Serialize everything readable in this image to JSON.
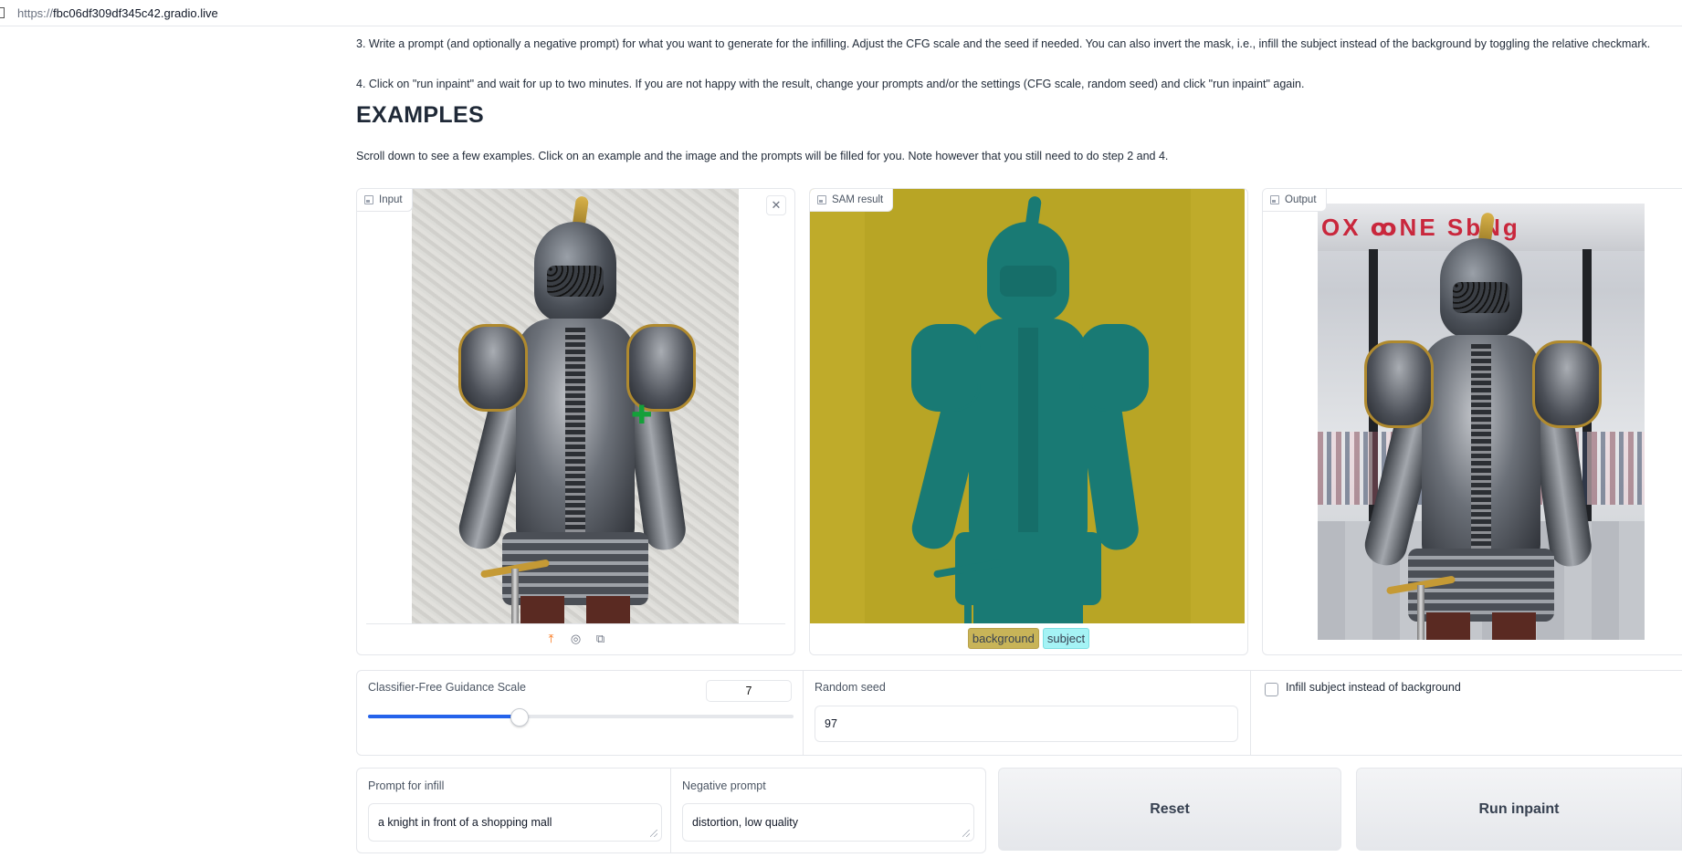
{
  "browser": {
    "url_proto": "https://",
    "url_host": "fbc06df309df345c42.gradio.live"
  },
  "instructions": {
    "step3": "3. Write a prompt (and optionally a negative prompt) for what you want to generate for the infilling. Adjust the CFG scale and the seed if needed. You can also invert the mask, i.e., infill the subject instead of the background by toggling the relative checkmark.",
    "step4": "4. Click on \"run inpaint\" and wait for up to two minutes. If you are not happy with the result, change your prompts and/or the settings (CFG scale, random seed) and click \"run inpaint\" again."
  },
  "examples": {
    "title": "EXAMPLES",
    "note": "Scroll down to see a few examples. Click on an example and the image and the prompts will be filled for you. Note however that you still need to do step 2 and 4."
  },
  "panels": {
    "input_label": "Input",
    "sam_label": "SAM result",
    "output_label": "Output",
    "close_symbol": "✕",
    "legend": {
      "background": "background",
      "subject": "subject"
    },
    "output_sign": "OX ꝏNE SbNg"
  },
  "controls": {
    "cfg_label": "Classifier-Free Guidance Scale",
    "cfg_value": "7",
    "cfg_fraction": 0.355,
    "seed_label": "Random seed",
    "seed_value": "97",
    "invert_label": "Infill subject instead of background",
    "invert_checked": false
  },
  "prompts": {
    "infill_label": "Prompt for infill",
    "infill_value": "a knight in front of a shopping mall",
    "negative_label": "Negative prompt",
    "negative_value": "distortion, low quality"
  },
  "buttons": {
    "reset": "Reset",
    "run": "Run inpaint"
  },
  "icons": {
    "upload": "upload-icon",
    "webcam": "webcam-icon",
    "clipboard": "clipboard-icon",
    "image": "image-icon",
    "close": "close-icon"
  },
  "colors": {
    "accent": "#2563eb",
    "mask_background": "#bfab2a",
    "mask_subject": "#197a74",
    "upload_icon": "#f97316"
  }
}
